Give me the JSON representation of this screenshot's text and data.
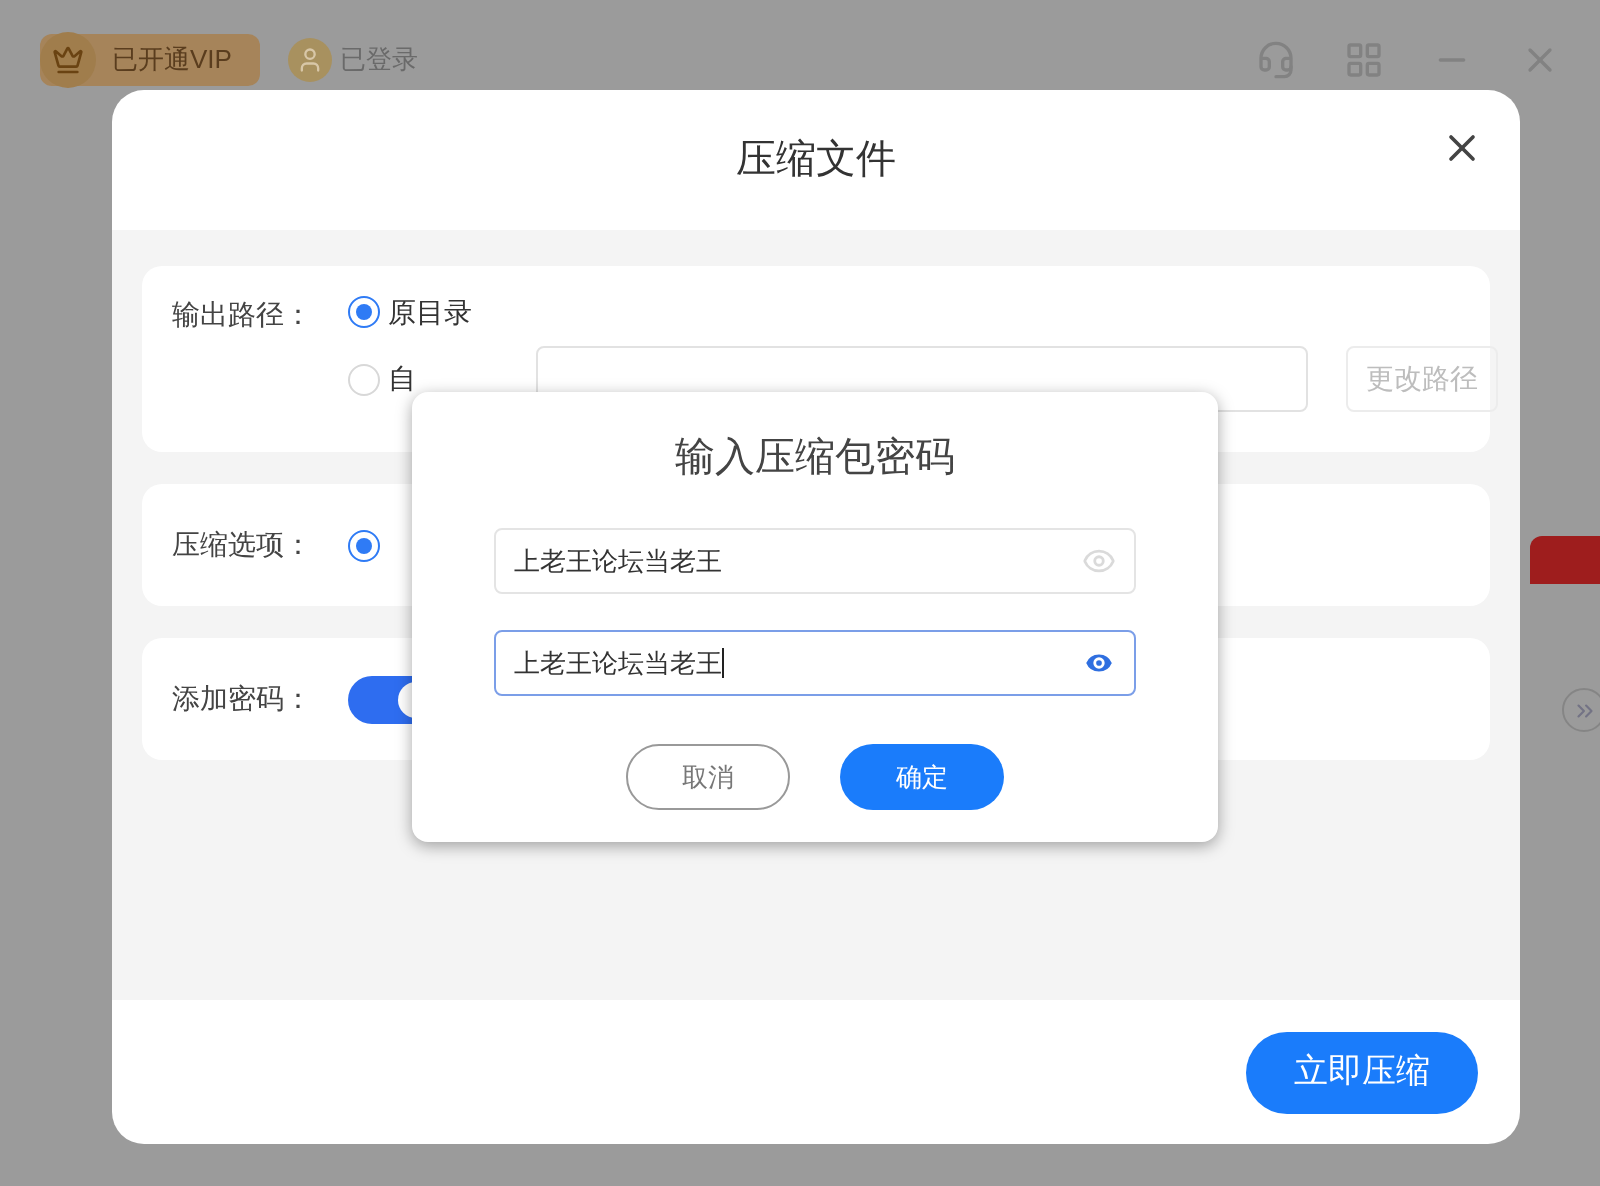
{
  "top_bar": {
    "vip_badge": "已开通VIP",
    "login_status": "已登录"
  },
  "dialog": {
    "title": "压缩文件",
    "output_path": {
      "label": "输出路径：",
      "options": [
        {
          "label": "原目录",
          "selected": true
        },
        {
          "label": "自",
          "selected": false
        }
      ],
      "change_button": "更改路径",
      "change_disabled": true
    },
    "compress_options": {
      "label": "压缩选项：",
      "selected": true
    },
    "add_password": {
      "label": "添加密码：",
      "on": true
    },
    "submit_button": "立即压缩"
  },
  "password_modal": {
    "title": "输入压缩包密码",
    "fields": [
      {
        "value": "上老王论坛当老王",
        "focused": false,
        "reveal": false
      },
      {
        "value": "上老王论坛当老王",
        "focused": true,
        "reveal": true
      }
    ],
    "buttons": [
      {
        "label": "取消",
        "kind": "secondary"
      },
      {
        "label": "确定",
        "kind": "primary"
      }
    ]
  }
}
